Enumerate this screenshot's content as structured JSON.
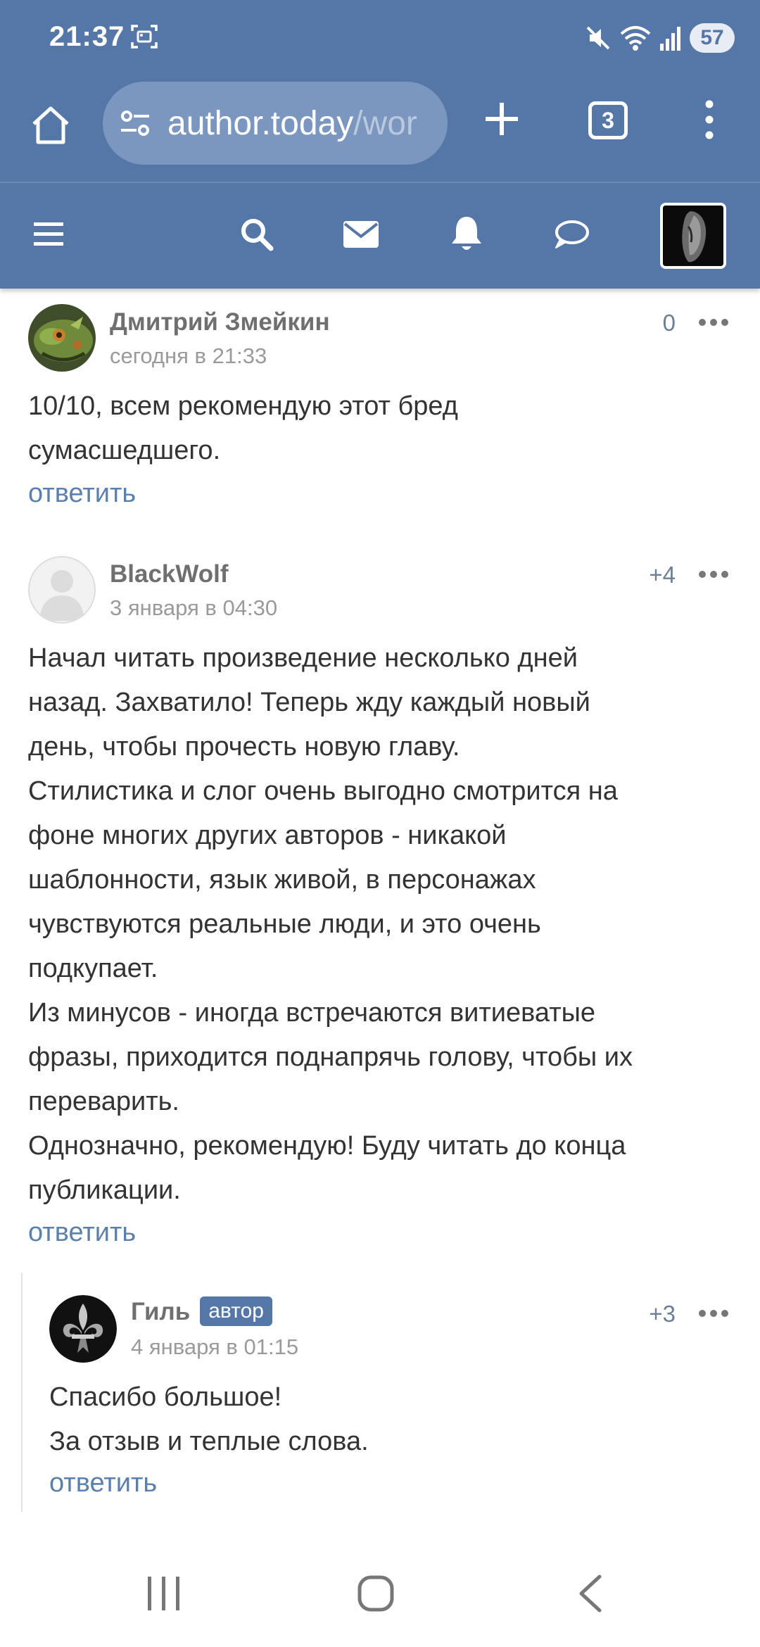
{
  "status_bar": {
    "time": "21:37",
    "battery": "57",
    "icons": [
      "screenshot-icon",
      "mute-icon",
      "wifi-icon",
      "signal-icon"
    ]
  },
  "browser": {
    "url_main": "author.today",
    "url_rest": "/wor",
    "tab_count": "3",
    "icons": [
      "home-icon",
      "site-settings-icon",
      "new-tab-icon",
      "menu-icon"
    ]
  },
  "site_nav": {
    "icons": [
      "hamburger-icon",
      "search-icon",
      "mail-icon",
      "bell-icon",
      "chat-icon"
    ]
  },
  "comments": [
    {
      "author": "Дмитрий Змейкин",
      "date": "сегодня в 21:33",
      "score": "0",
      "lines": [
        "10/10, всем рекомендую этот бред",
        "сумасшедшего."
      ],
      "reply": "ответить"
    },
    {
      "author": "BlackWolf",
      "date": "3 января в 04:30",
      "score": "+4",
      "lines": [
        "Начал читать произведение несколько дней",
        "назад. Захватило! Теперь жду каждый новый",
        "день, чтобы прочесть новую главу.",
        "Стилистика и слог очень выгодно смотрится на",
        "фоне многих других авторов - никакой",
        "шаблонности, язык живой, в персонажах",
        "чувствуются реальные люди, и это очень",
        "подкупает.",
        "Из минусов - иногда встречаются витиеватые",
        "фразы, приходится поднапрячь голову, чтобы их",
        "переварить.",
        "Однозначно, рекомендую! Буду читать до конца",
        "публикации."
      ],
      "reply": "ответить"
    },
    {
      "author": "Гиль",
      "badge": "автор",
      "date": "4 января в 01:15",
      "score": "+3",
      "lines": [
        "Спасибо большое!",
        "За отзыв и теплые слова."
      ],
      "reply": "ответить"
    }
  ],
  "colors": {
    "header_blue": "#5577a8",
    "link_blue": "#5b80ad"
  }
}
